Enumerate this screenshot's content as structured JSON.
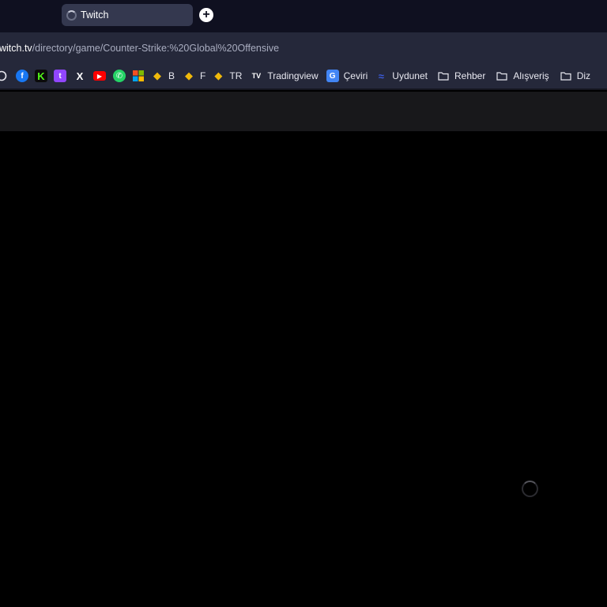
{
  "tab": {
    "title": "Twitch",
    "new_tab_symbol": "+"
  },
  "address": {
    "host": "witch.tv",
    "path": "/directory/game/Counter-Strike:%20Global%20Offensive"
  },
  "bookmarks": [
    {
      "name": "partial-icon",
      "label": "",
      "icon": "circle",
      "color": "#e8e8f0"
    },
    {
      "name": "facebook",
      "label": "",
      "icon": "f",
      "color": "#1877f2"
    },
    {
      "name": "kick",
      "label": "",
      "icon": "K",
      "color": "#53fc18"
    },
    {
      "name": "twitch",
      "label": "",
      "icon": "t",
      "color": "#9146ff"
    },
    {
      "name": "x",
      "label": "",
      "icon": "X",
      "color": "#ffffff"
    },
    {
      "name": "youtube",
      "label": "",
      "icon": "▶",
      "color": "#ff0000"
    },
    {
      "name": "whatsapp",
      "label": "",
      "icon": "✆",
      "color": "#25d366"
    },
    {
      "name": "microsoft",
      "label": "",
      "icon": "ms",
      "color": "#f25022"
    },
    {
      "name": "binance-b",
      "label": "B",
      "icon": "◆",
      "color": "#f0b90b"
    },
    {
      "name": "binance-f",
      "label": "F",
      "icon": "◆",
      "color": "#f0b90b"
    },
    {
      "name": "binance-tr",
      "label": "TR",
      "icon": "◆",
      "color": "#f0b90b"
    },
    {
      "name": "tradingview",
      "label": "Tradingview",
      "icon": "TV",
      "color": "#ffffff"
    },
    {
      "name": "ceviri",
      "label": "Çeviri",
      "icon": "G",
      "color": "#4285f4"
    },
    {
      "name": "uydunet",
      "label": "Uydunet",
      "icon": "≈",
      "color": "#3b5bdb"
    },
    {
      "name": "folder-rehber",
      "label": "Rehber",
      "icon": "folder",
      "color": "#e8e8f0"
    },
    {
      "name": "folder-alisveris",
      "label": "Alışveriş",
      "icon": "folder",
      "color": "#e8e8f0"
    },
    {
      "name": "folder-diz",
      "label": "Diz",
      "icon": "folder",
      "color": "#e8e8f0"
    }
  ],
  "colors": {
    "tabstrip": "#0f1020",
    "toolbar": "#25283a",
    "page": "#000000"
  }
}
